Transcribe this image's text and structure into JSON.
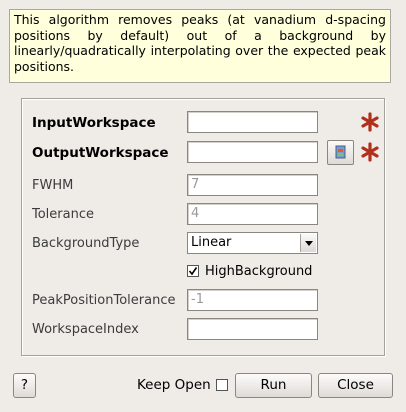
{
  "description": "This algorithm removes peaks (at vanadium d-spacing positions by default) out of a background by linearly/quadratically interpolating over the expected peak positions.",
  "fields": {
    "input_workspace": {
      "label": "InputWorkspace",
      "value": "",
      "required": true
    },
    "output_workspace": {
      "label": "OutputWorkspace",
      "value": "",
      "required": true
    },
    "fwhm": {
      "label": "FWHM",
      "placeholder": "7"
    },
    "tolerance": {
      "label": "Tolerance",
      "placeholder": "4"
    },
    "background_type": {
      "label": "BackgroundType",
      "value": "Linear"
    },
    "high_background": {
      "label": "HighBackground",
      "checked": true
    },
    "peak_position_tolerance": {
      "label": "PeakPositionTolerance",
      "placeholder": "-1"
    },
    "workspace_index": {
      "label": "WorkspaceIndex",
      "value": ""
    }
  },
  "footer": {
    "help_label": "?",
    "keep_open_label": "Keep Open",
    "keep_open_checked": false,
    "run_label": "Run",
    "close_label": "Close"
  },
  "colors": {
    "required_star": "#b0301c",
    "description_bg": "#ffffdc",
    "window_bg": "#efebe7"
  },
  "icons": {
    "required": "star-icon",
    "browse": "workspace-browse-icon",
    "dropdown": "chevron-down-icon",
    "check": "checkmark-icon"
  }
}
